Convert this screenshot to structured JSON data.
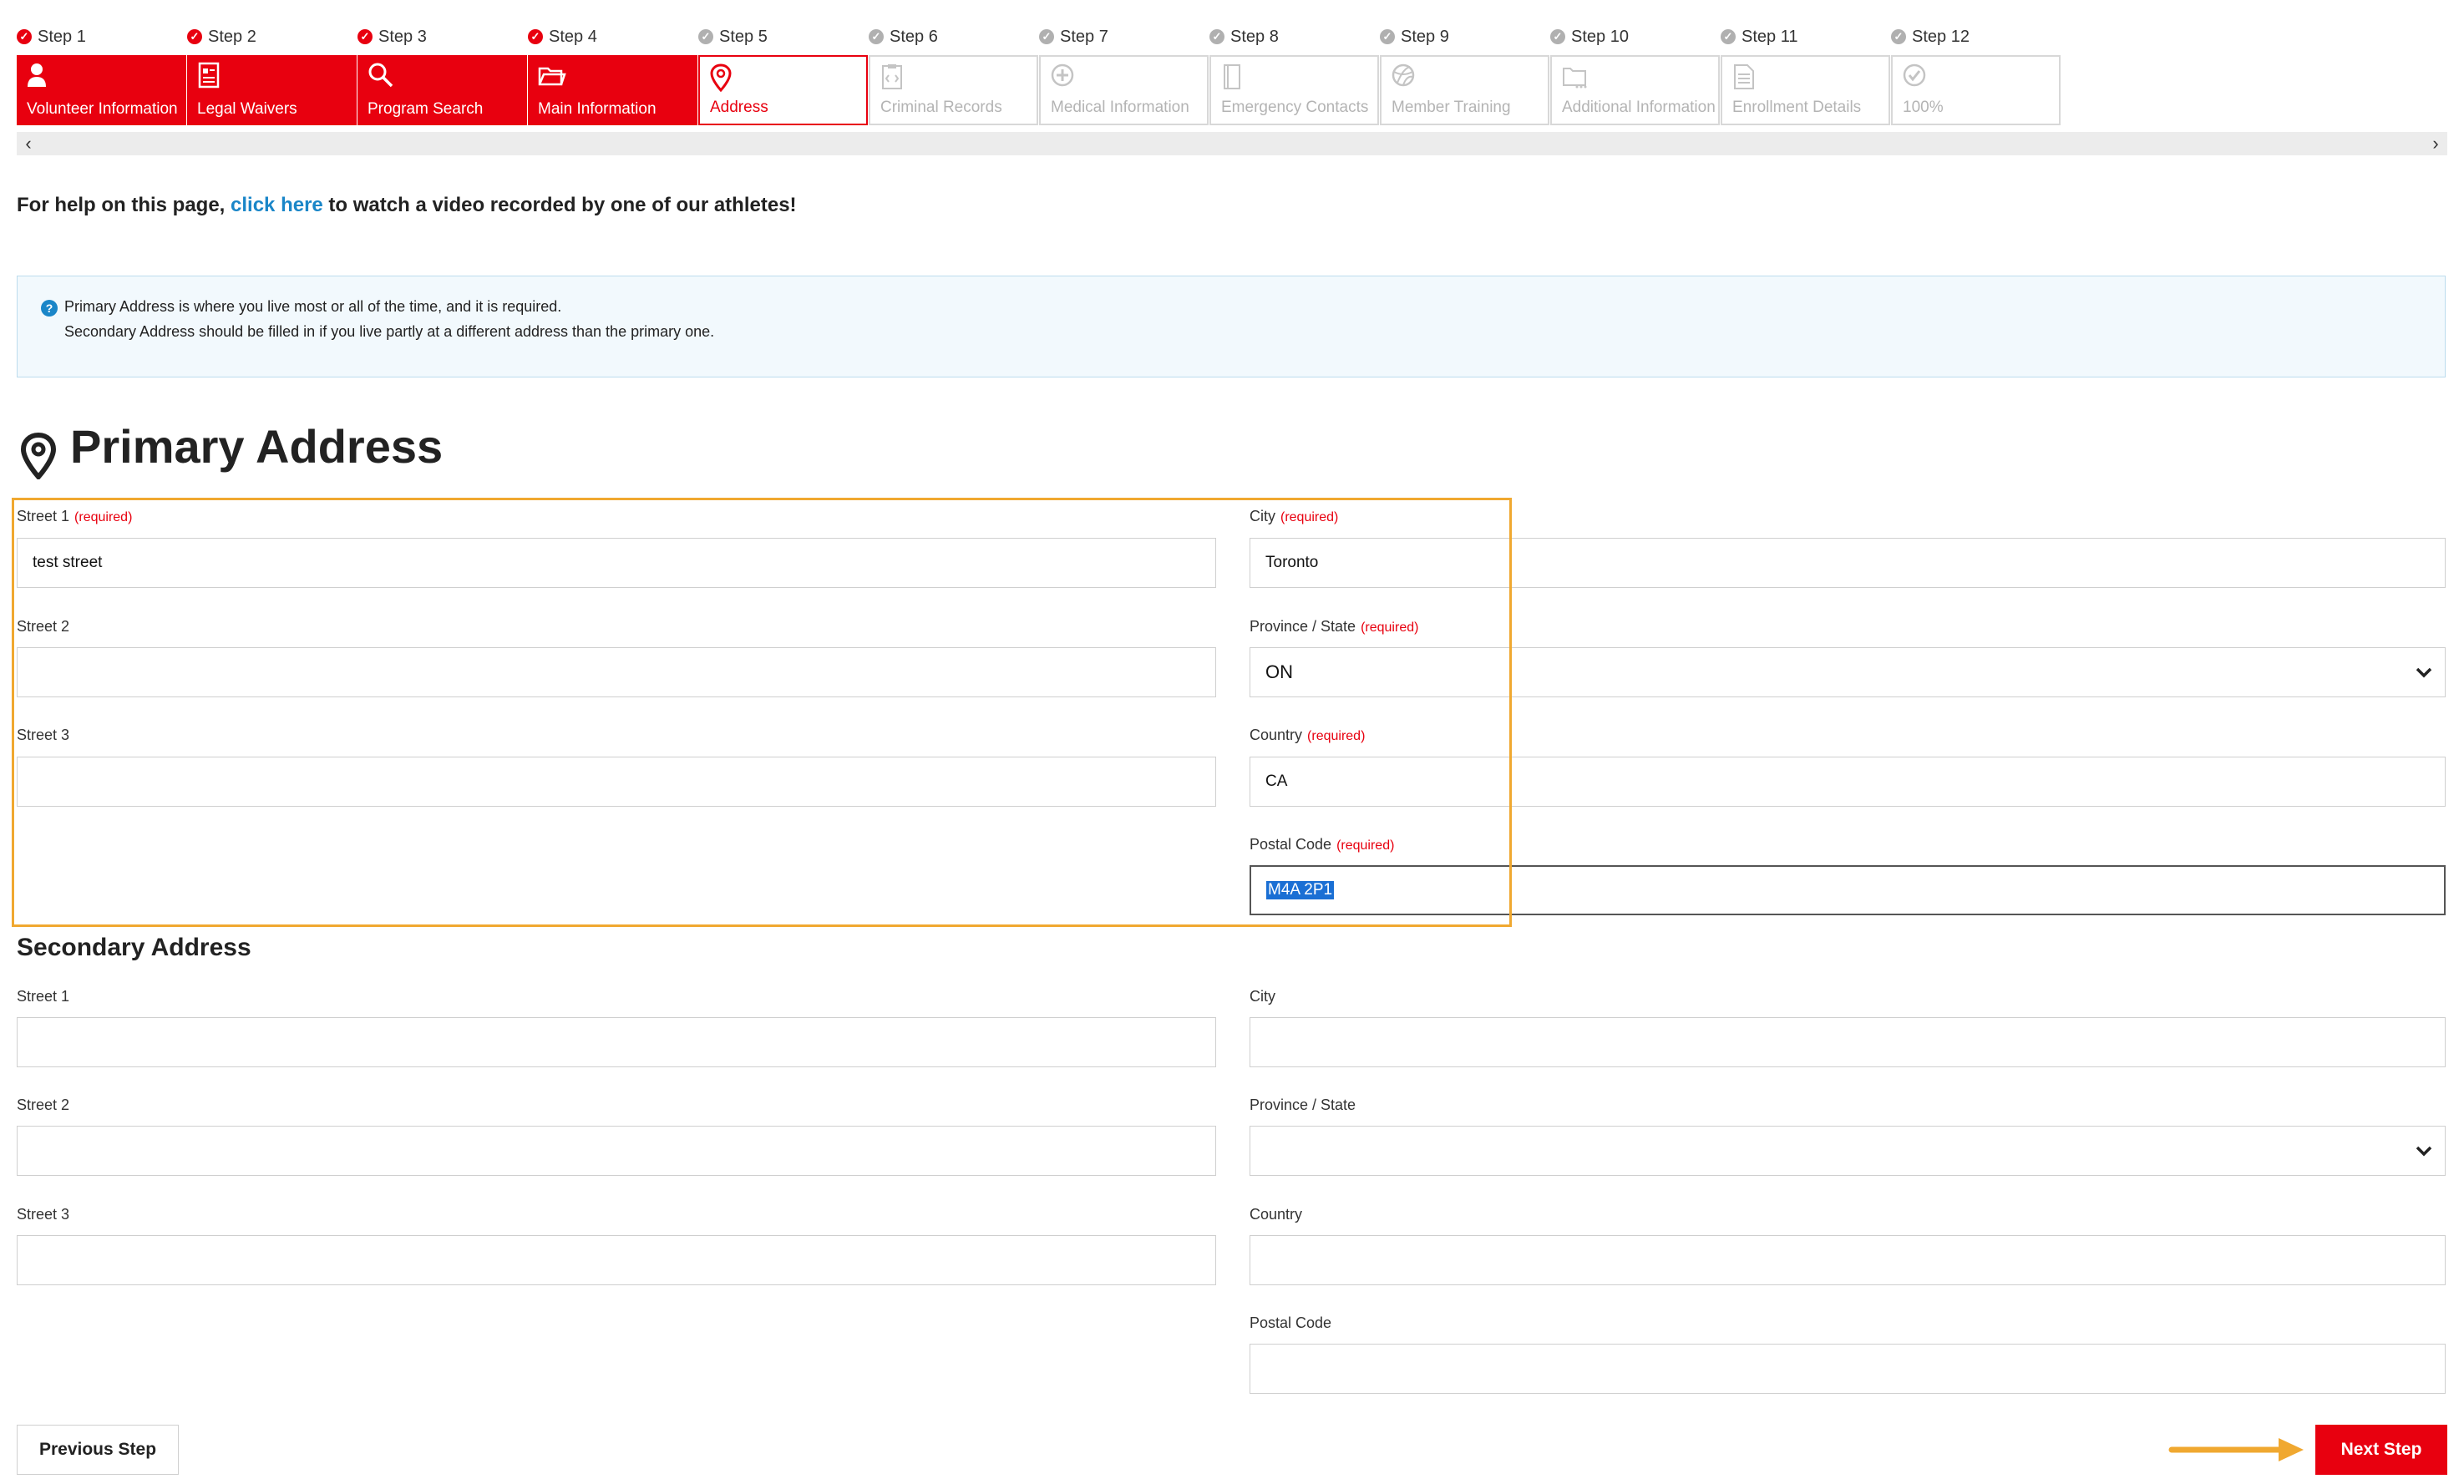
{
  "stepper": {
    "steps": [
      {
        "header": "Step 1",
        "label": "Volunteer Information",
        "state": "done",
        "icon": "person-icon"
      },
      {
        "header": "Step 2",
        "label": "Legal Waivers",
        "state": "done",
        "icon": "document-icon"
      },
      {
        "header": "Step 3",
        "label": "Program Search",
        "state": "done",
        "icon": "search-icon"
      },
      {
        "header": "Step 4",
        "label": "Main Information",
        "state": "done",
        "icon": "folder-icon"
      },
      {
        "header": "Step 5",
        "label": "Address",
        "state": "active",
        "icon": "map-pin-icon"
      },
      {
        "header": "Step 6",
        "label": "Criminal Records",
        "state": "todo",
        "icon": "record-icon"
      },
      {
        "header": "Step 7",
        "label": "Medical Information",
        "state": "todo",
        "icon": "medical-plus-icon"
      },
      {
        "header": "Step 8",
        "label": "Emergency Contacts",
        "state": "todo",
        "icon": "contact-card-icon"
      },
      {
        "header": "Step 9",
        "label": "Member Training",
        "state": "todo",
        "icon": "ball-icon"
      },
      {
        "header": "Step 10",
        "label": "Additional Information",
        "state": "todo",
        "icon": "folder-dots-icon"
      },
      {
        "header": "Step 11",
        "label": "Enrollment Details",
        "state": "todo",
        "icon": "page-icon"
      },
      {
        "header": "Step 12",
        "label": "100%",
        "state": "todo",
        "icon": "check-circle-icon"
      }
    ]
  },
  "help": {
    "prefix": "For help on this page, ",
    "link": "click here",
    "suffix": " to watch a video recorded by one of our athletes!"
  },
  "info": {
    "line1": "Primary Address is where you live most or all of the time, and it is required.",
    "line2": "Secondary Address should be filled in if you live partly at a different address than the primary one."
  },
  "primary": {
    "title": "Primary Address",
    "required_tag": "(required)",
    "street1_label": "Street 1",
    "street1_value": "test street",
    "street2_label": "Street 2",
    "street2_value": "",
    "street3_label": "Street 3",
    "street3_value": "",
    "city_label": "City",
    "city_value": "Toronto",
    "province_label": "Province / State",
    "province_value": "ON",
    "country_label": "Country",
    "country_value": "CA",
    "postal_label": "Postal Code",
    "postal_value": "M4A 2P1"
  },
  "secondary": {
    "title": "Secondary Address",
    "street1_label": "Street 1",
    "street2_label": "Street 2",
    "street3_label": "Street 3",
    "city_label": "City",
    "province_label": "Province / State",
    "country_label": "Country",
    "postal_label": "Postal Code"
  },
  "buttons": {
    "prev": "Previous Step",
    "next": "Next Step"
  },
  "colors": {
    "accent": "#e8000f",
    "link": "#1a86c8",
    "annotation": "#f0a830"
  }
}
